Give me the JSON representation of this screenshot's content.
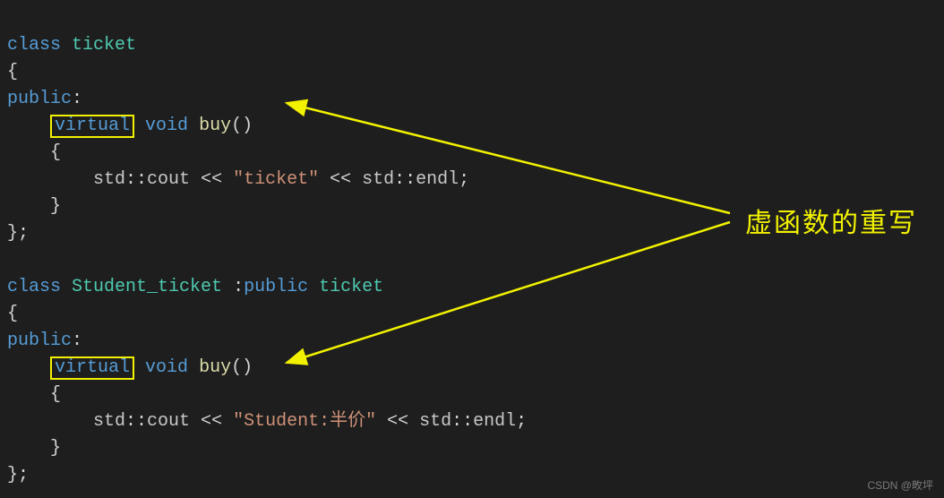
{
  "code": {
    "class1_kw": "class",
    "class1_name": "ticket",
    "brace_open": "{",
    "public_kw": "public",
    "colon": ":",
    "virtual_kw": "virtual",
    "void_kw": "void",
    "buy_fn": "buy",
    "parens": "()",
    "cout_ns": "std",
    "dcol": "::",
    "cout_id": "cout",
    "lshift": " << ",
    "str_ticket": "\"ticket\"",
    "endl_id": "endl",
    "semi": ";",
    "brace_close": "}",
    "class2_kw": "class",
    "class2_name": "Student_ticket",
    "inherit_sep": " :",
    "public_inh": "public",
    "base_name": "ticket",
    "str_student": "\"Student:半价\""
  },
  "annotation": {
    "label": "虚函数的重写"
  },
  "watermark": "CSDN @畋坪"
}
